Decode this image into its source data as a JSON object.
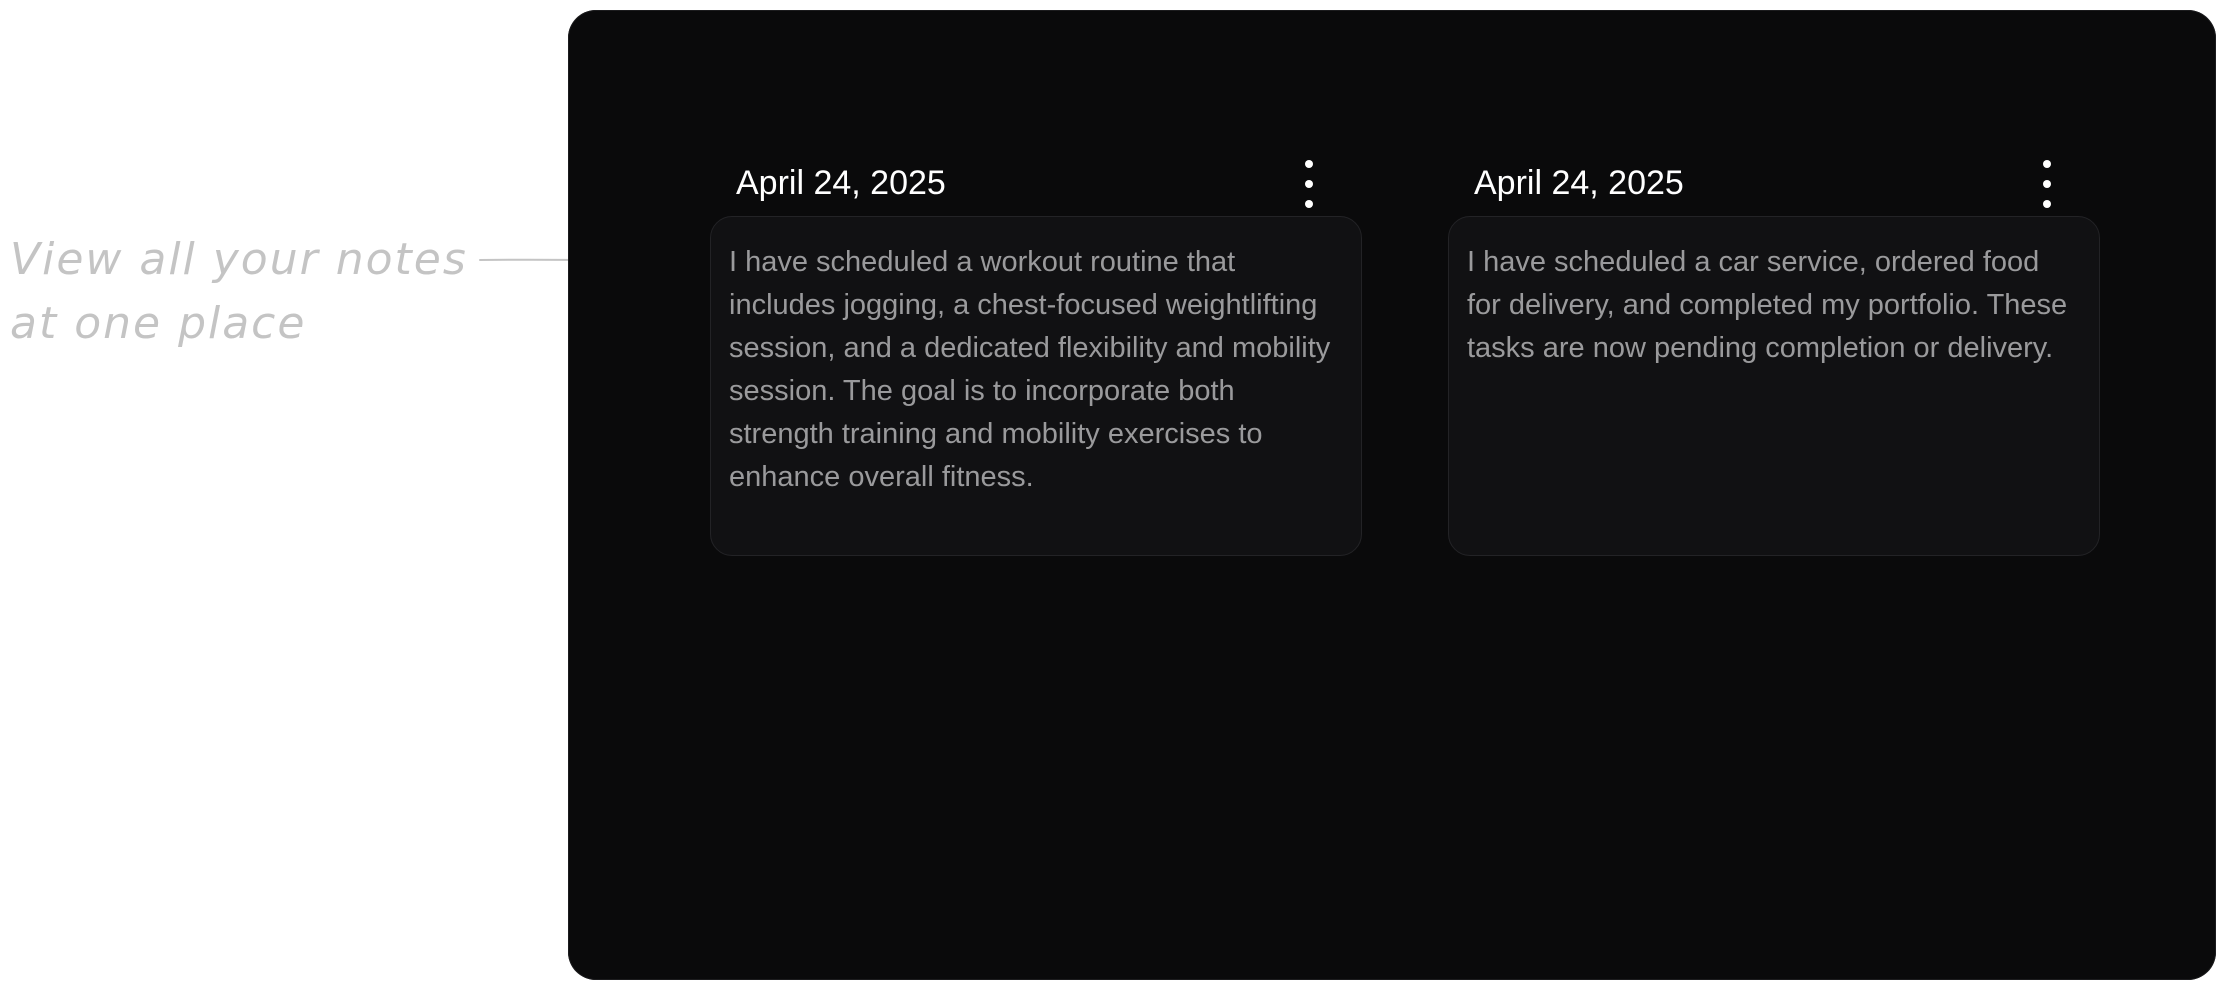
{
  "annotation": {
    "text": "View all your notes\nat one place"
  },
  "notes": [
    {
      "date": "April 24, 2025",
      "content": "I have scheduled a workout routine that includes jogging, a chest-focused weightlifting session, and a dedicated flexibility and mobility session. The goal is to incorporate both strength training and mobility exercises to enhance overall fitness.",
      "menu_icon": "kebab-menu-icon"
    },
    {
      "date": "April 24, 2025",
      "content": "I have scheduled a car service, ordered food for delivery, and completed my portfolio. These tasks are now pending completion or delivery.",
      "menu_icon": "kebab-menu-icon"
    }
  ],
  "colors": {
    "window_background": "#0a0a0b",
    "card_background": "#111113",
    "card_border": "#232326",
    "date_text": "#ffffff",
    "body_text": "#9a9a9c",
    "annotation_text": "#c4c4c4"
  }
}
